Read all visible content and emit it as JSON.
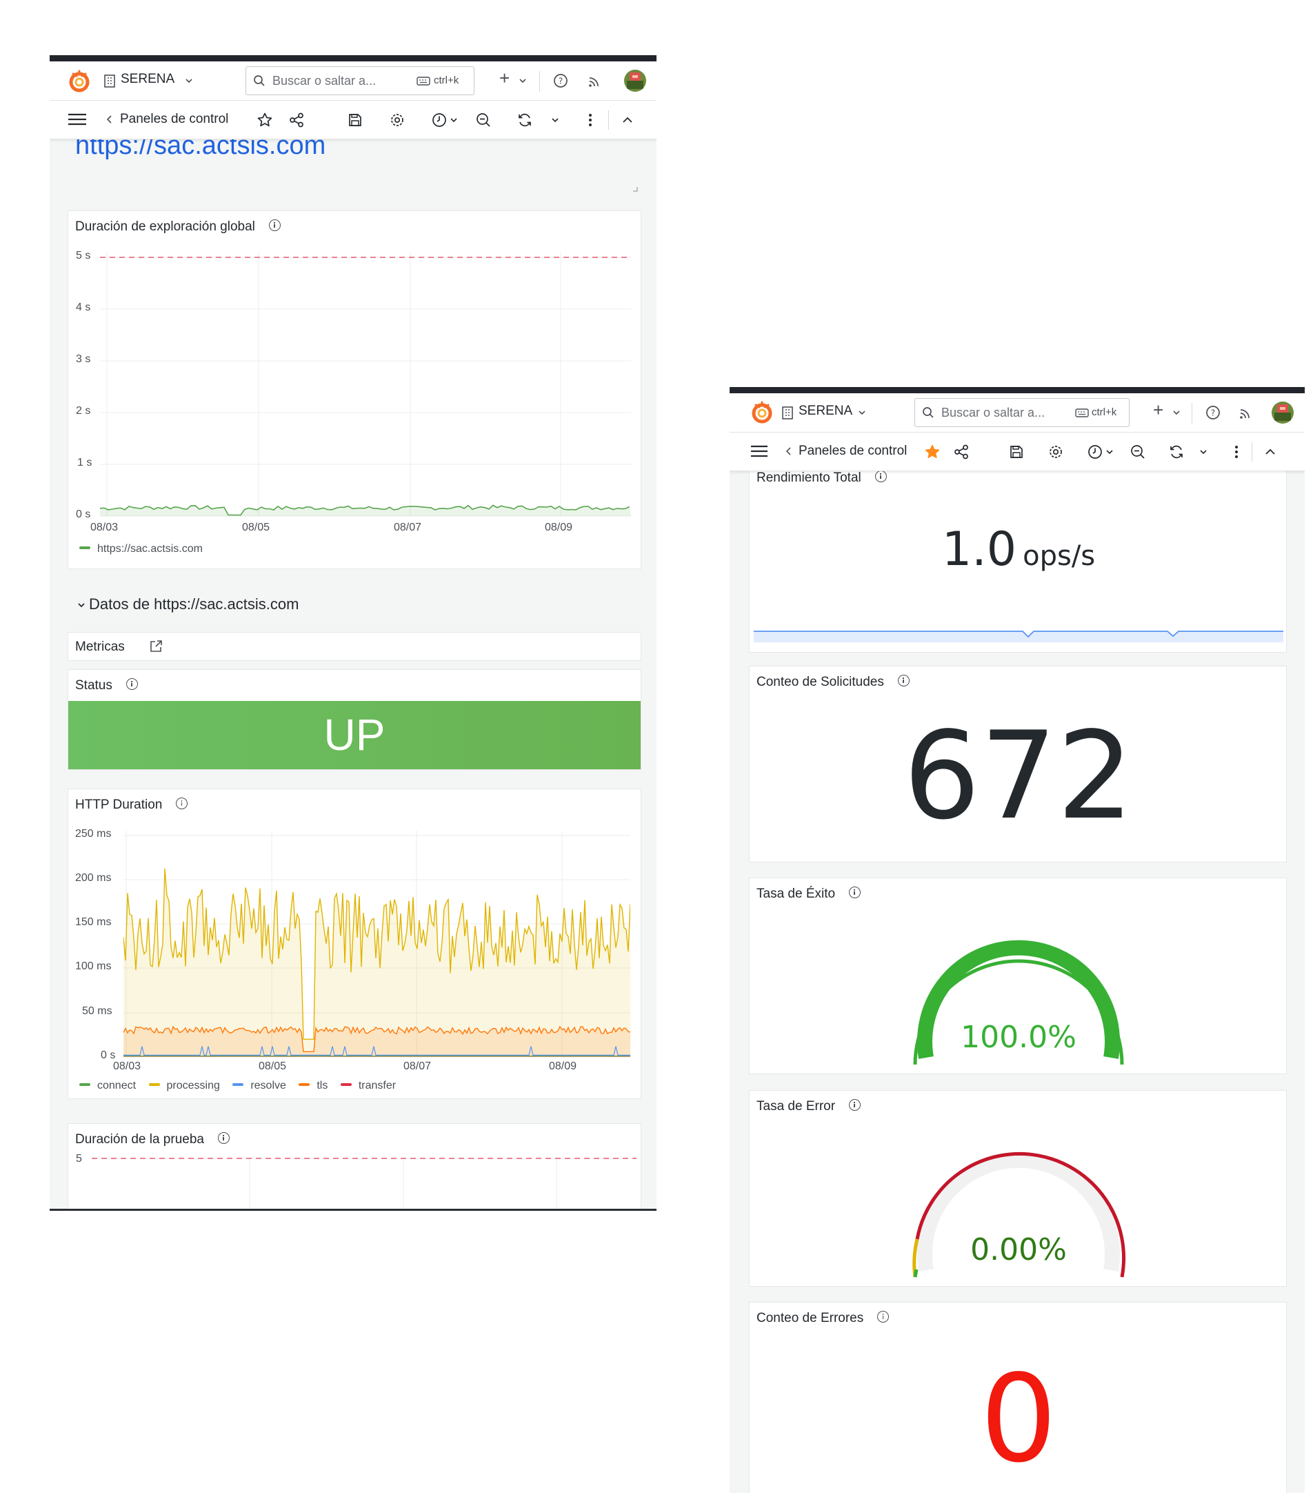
{
  "left_window": {
    "org": "SERENA",
    "search_placeholder": "Buscar o saltar a...",
    "search_shortcut": "ctrl+k",
    "plus_label": "+",
    "breadcrumb": "Paneles de control",
    "url_heading": "https://sac.actsis.com",
    "section_title": "Datos de https://sac.actsis.com",
    "panels": {
      "global_duration": {
        "title": "Duración de exploración global",
        "y_ticks": [
          "5 s",
          "4 s",
          "3 s",
          "2 s",
          "1 s",
          "0 s"
        ],
        "x_ticks": [
          "08/03",
          "08/05",
          "08/07",
          "08/09"
        ],
        "legend": "https://sac.actsis.com"
      },
      "metricas": {
        "title": "Metricas"
      },
      "status": {
        "title": "Status",
        "value": "UP"
      },
      "http_duration": {
        "title": "HTTP Duration",
        "y_ticks": [
          "250 ms",
          "200 ms",
          "150 ms",
          "100 ms",
          "50 ms",
          "0 s"
        ],
        "x_ticks": [
          "08/03",
          "08/05",
          "08/07",
          "08/09"
        ],
        "legend": [
          "connect",
          "processing",
          "resolve",
          "tls",
          "transfer"
        ]
      },
      "test_duration": {
        "title": "Duración de la prueba",
        "y_tick": "5"
      }
    }
  },
  "right_window": {
    "org": "SERENA",
    "search_placeholder": "Buscar o saltar a...",
    "search_shortcut": "ctrl+k",
    "plus_label": "+",
    "breadcrumb": "Paneles de control",
    "panels": {
      "throughput": {
        "title": "Rendimiento Total",
        "value": "1.0",
        "unit": "ops/s"
      },
      "requests": {
        "title": "Conteo de Solicitudes",
        "value": "672"
      },
      "success": {
        "title": "Tasa de Éxito",
        "value": "100.0%",
        "gauge_fraction": 1.0
      },
      "error_rate": {
        "title": "Tasa de Error",
        "value": "0.00%",
        "gauge_fraction": 0.0
      },
      "error_count": {
        "title": "Conteo de Errores",
        "value": "0"
      }
    }
  },
  "colors": {
    "link_blue": "#1f62e0",
    "status_green": "#6cbf5f",
    "connect": "#56a64b",
    "processing": "#e0b400",
    "resolve": "#5794f2",
    "tls": "#ff780a",
    "transfer": "#e02f44",
    "success_gauge": "#37b034",
    "error_gauge": "#c4162a",
    "error_count": "#f2190f",
    "star_orange": "#ff8c1a"
  },
  "chart_data": [
    {
      "type": "line",
      "title": "Duración de exploración global",
      "x": [
        "08/03",
        "08/04",
        "08/05",
        "08/06",
        "08/07",
        "08/08",
        "08/09",
        "08/10"
      ],
      "ylim": [
        0,
        5
      ],
      "y_unit": "s",
      "threshold": 5,
      "series": [
        {
          "name": "https://sac.actsis.com",
          "values": [
            0.15,
            0.17,
            0.15,
            0.16,
            0.15,
            0.17,
            0.16,
            0.16
          ]
        }
      ]
    },
    {
      "type": "line",
      "title": "HTTP Duration",
      "x": [
        "08/03",
        "08/04",
        "08/05",
        "08/06",
        "08/07",
        "08/08",
        "08/09",
        "08/10"
      ],
      "ylim": [
        0,
        250
      ],
      "y_unit": "ms",
      "series": [
        {
          "name": "connect",
          "values": [
            1,
            1,
            1,
            1,
            1,
            1,
            1,
            1
          ]
        },
        {
          "name": "processing",
          "values": [
            140,
            145,
            150,
            140,
            140,
            138,
            142,
            145
          ]
        },
        {
          "name": "resolve",
          "values": [
            2,
            2,
            2,
            2,
            2,
            2,
            2,
            2
          ]
        },
        {
          "name": "tls",
          "values": [
            30,
            31,
            30,
            30,
            30,
            29,
            31,
            30
          ]
        },
        {
          "name": "transfer",
          "values": [
            1,
            1,
            1,
            1,
            1,
            1,
            1,
            1
          ]
        }
      ]
    },
    {
      "type": "line",
      "title": "Duración de la prueba",
      "threshold": 5,
      "series": []
    }
  ]
}
